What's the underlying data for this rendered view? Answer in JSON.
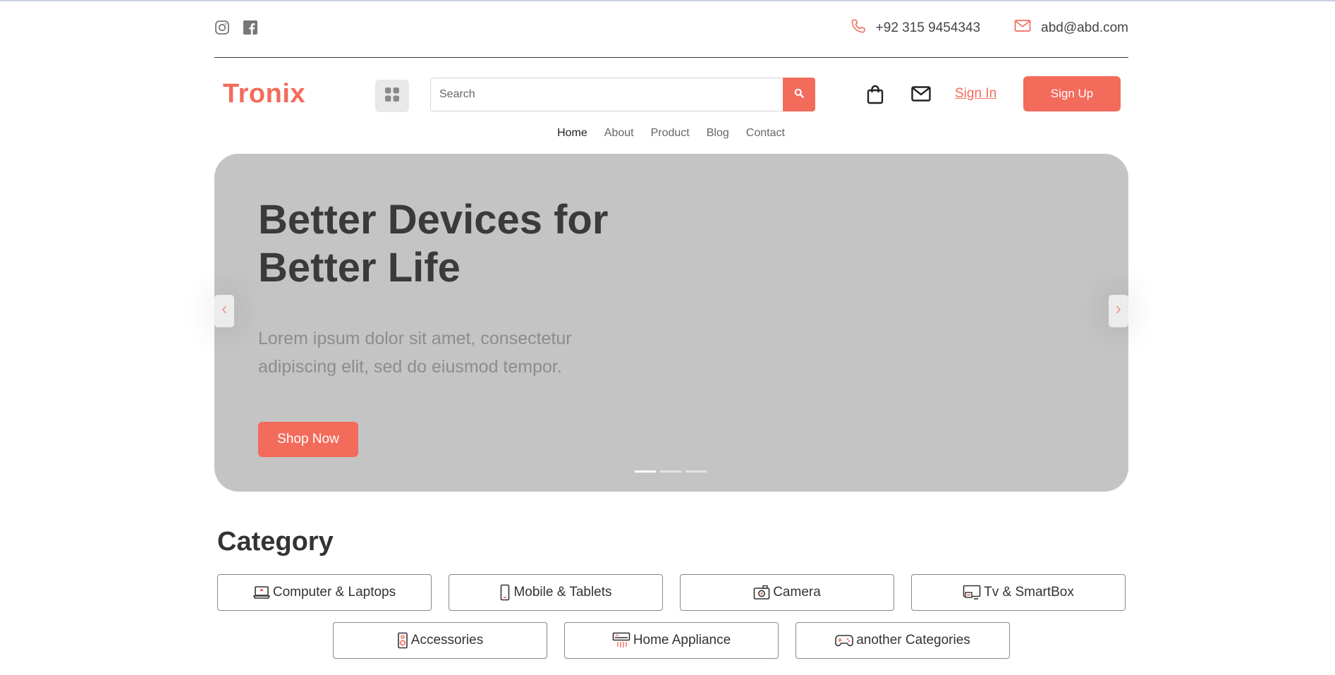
{
  "topbar": {
    "social": [
      "instagram-icon",
      "facebook-icon"
    ],
    "phone": "+92 315 9454343",
    "email": "abd@abd.com"
  },
  "header": {
    "logo": "Tronix",
    "search_placeholder": "Search",
    "signin_label": "Sign In",
    "signup_label": "Sign Up"
  },
  "nav": {
    "items": [
      "Home",
      "About",
      "Product",
      "Blog",
      "Contact"
    ],
    "active": "Home"
  },
  "hero": {
    "title_line1": "Better Devices for",
    "title_line2": "Better Life",
    "text": "Lorem ipsum dolor sit amet, consectetur adipiscing elit, sed do eiusmod tempor.",
    "cta": "Shop Now",
    "slides": 3,
    "active_slide": 1
  },
  "category": {
    "title": "Category",
    "items": [
      {
        "label": "Computer & Laptops",
        "icon": "laptop-icon"
      },
      {
        "label": "Mobile & Tablets",
        "icon": "mobile-icon"
      },
      {
        "label": "Camera",
        "icon": "camera-icon"
      },
      {
        "label": "Tv & SmartBox",
        "icon": "tv-icon"
      },
      {
        "label": "Accessories",
        "icon": "speaker-icon"
      },
      {
        "label": "Home Appliance",
        "icon": "air-conditioner-icon"
      },
      {
        "label": "another Categories",
        "icon": "gamepad-icon"
      }
    ]
  },
  "colors": {
    "accent": "#f36b5b",
    "hero_bg": "#c4c4c4",
    "text_dark": "#3a3a3a"
  }
}
